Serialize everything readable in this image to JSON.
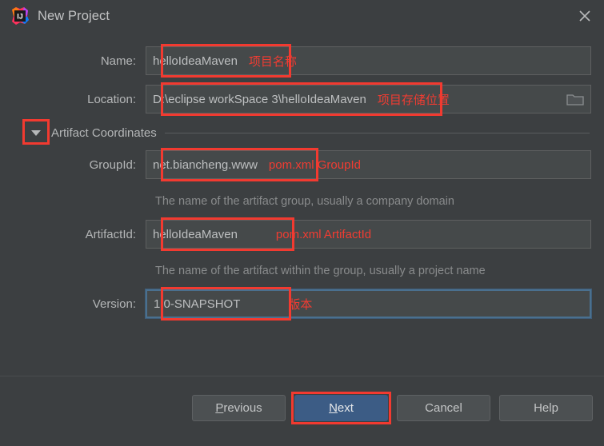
{
  "window": {
    "title": "New Project",
    "app_icon": "intellij-idea-icon",
    "close_icon": "close-icon"
  },
  "colors": {
    "background": "#3c3f41",
    "field_background": "#45494a",
    "field_border": "#5e6060",
    "annotation_red": "#f23a30",
    "annotation_text_red": "#f03c32",
    "focus_blue": "#4a708f",
    "default_button_blue": "#3c5c85",
    "label_text": "#b4b6b7",
    "helper_text": "#898b8c"
  },
  "form": {
    "name": {
      "label": "Name:",
      "value": "helloIdeaMaven",
      "annotation": "项目名称",
      "annotated": true
    },
    "location": {
      "label": "Location:",
      "value": "D:\\eclipse workSpace 3\\helloIdeaMaven",
      "annotation": "项目存储位置",
      "annotated": true,
      "browse_icon": "folder-icon"
    },
    "section": {
      "label": "Artifact Coordinates",
      "expanded": true,
      "twisty_icon": "chevron-down-icon",
      "twisty_annotated": true
    },
    "group_id": {
      "label": "GroupId:",
      "value": "net.biancheng.www",
      "annotation": "pom.xml GroupId",
      "annotated": true,
      "helper": "The name of the artifact group, usually a company domain"
    },
    "artifact_id": {
      "label": "ArtifactId:",
      "value": "helloIdeaMaven",
      "annotation": "pom.xml ArtifactId",
      "annotated": true,
      "helper": "The name of the artifact within the group, usually a project name"
    },
    "version": {
      "label": "Version:",
      "value": "1.0-SNAPSHOT",
      "annotation": "版本",
      "annotated": true,
      "focused": true
    }
  },
  "footer": {
    "previous": {
      "label": "Previous",
      "mnemonic": "P"
    },
    "next": {
      "label": "Next",
      "mnemonic": "N",
      "default": true,
      "annotated": true
    },
    "cancel": {
      "label": "Cancel"
    },
    "help": {
      "label": "Help"
    }
  }
}
